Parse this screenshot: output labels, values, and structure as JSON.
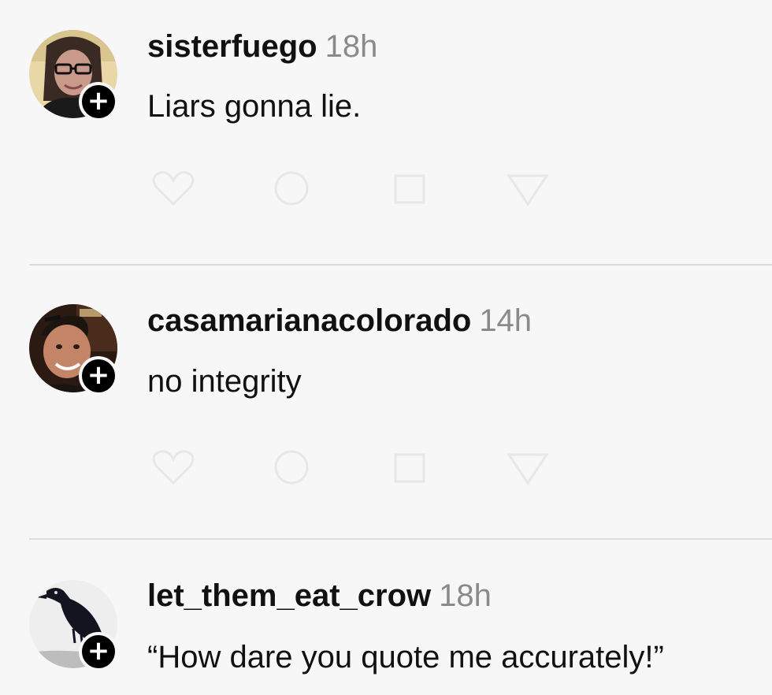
{
  "comments": [
    {
      "username": "sisterfuego",
      "timestamp": "18h",
      "text": "Liars gonna lie.",
      "follow_icon": "plus"
    },
    {
      "username": "casamarianacolorado",
      "timestamp": "14h",
      "text": "no integrity",
      "follow_icon": "plus"
    },
    {
      "username": "let_them_eat_crow",
      "timestamp": "18h",
      "text": "“How dare you quote me accurately!”",
      "follow_icon": "plus"
    }
  ],
  "action_icons": [
    "heart-icon",
    "comment-icon",
    "repost-icon",
    "share-icon"
  ],
  "colors": {
    "background": "#f7f7f7",
    "username": "#111111",
    "timestamp": "#8a8a8a",
    "follow_button": "#000000",
    "divider": "#dcdcdc"
  }
}
